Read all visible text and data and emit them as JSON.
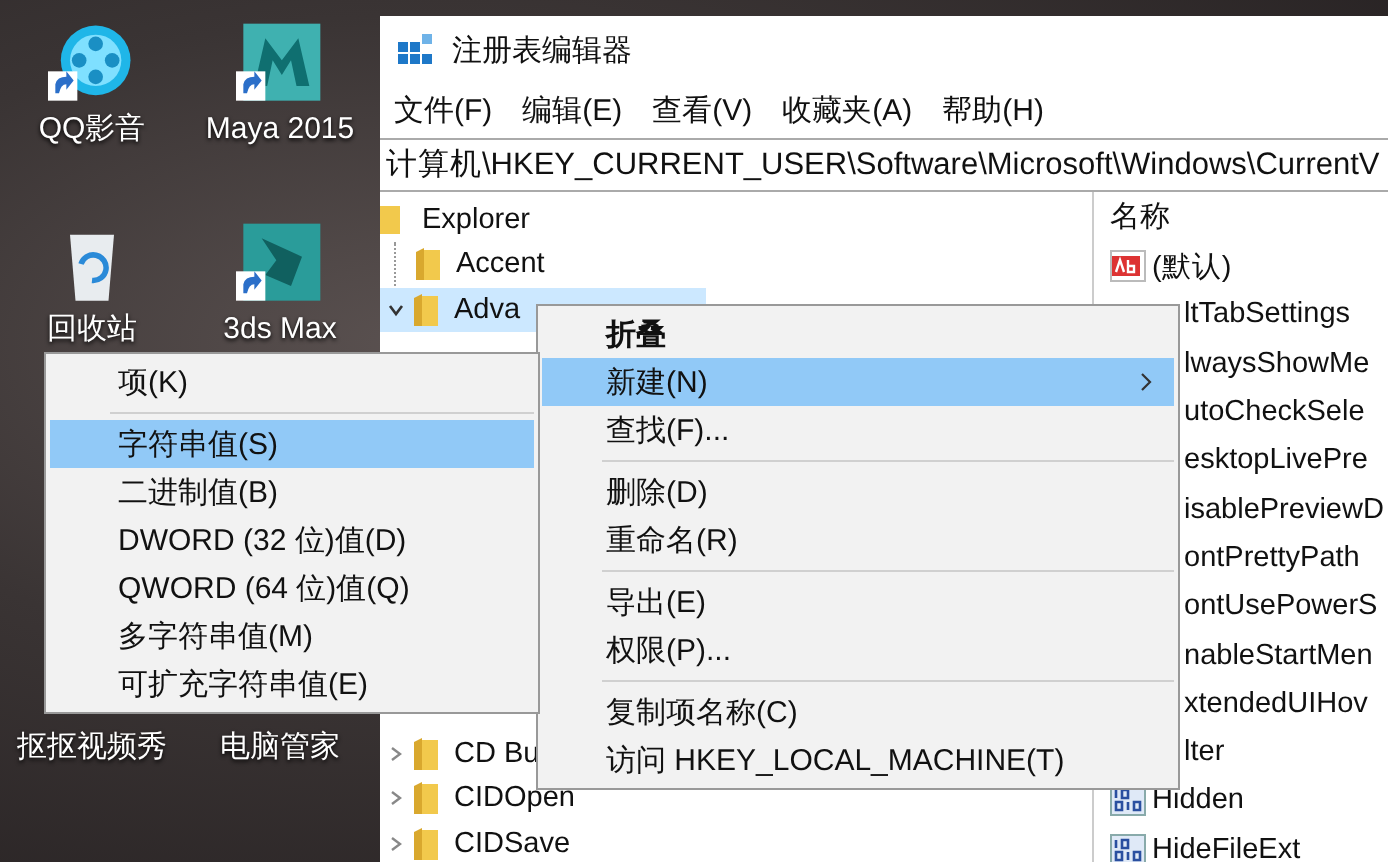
{
  "desktop": {
    "icons": [
      {
        "label": "QQ影音",
        "kind": "player",
        "shortcut": true
      },
      {
        "label": "Maya 2015",
        "kind": "maya",
        "shortcut": true
      },
      {
        "label": "回收站",
        "kind": "recycle",
        "shortcut": false
      },
      {
        "label": "3ds Max",
        "kind": "max",
        "shortcut": true
      },
      {
        "label": "抠抠视频秀",
        "kind": "covered"
      },
      {
        "label": "电脑管家",
        "kind": "covered"
      }
    ]
  },
  "window": {
    "title": "注册表编辑器",
    "menu": [
      "文件(F)",
      "编辑(E)",
      "查看(V)",
      "收藏夹(A)",
      "帮助(H)"
    ],
    "address": "计算机\\HKEY_CURRENT_USER\\Software\\Microsoft\\Windows\\CurrentV",
    "tree": [
      {
        "label": "Explorer",
        "selected": false,
        "children": [
          {
            "label": "Accent",
            "has_children": false,
            "selected": false
          },
          {
            "label": "Adva",
            "has_children": true,
            "expanded": true,
            "selected": true
          },
          {
            "label": "CD Bu",
            "has_children": true,
            "expanded": false,
            "selected": false
          },
          {
            "label": "CIDOpen",
            "has_children": true,
            "expanded": false,
            "selected": false
          },
          {
            "label": "CIDSave",
            "has_children": true,
            "expanded": false,
            "selected": false
          }
        ]
      }
    ],
    "values_header": "名称",
    "values": [
      {
        "name": "(默认)",
        "kind": "string"
      },
      {
        "name": "ltTabSettings",
        "kind": "clipped"
      },
      {
        "name": "lwaysShowMe",
        "kind": "clipped"
      },
      {
        "name": "utoCheckSele",
        "kind": "clipped"
      },
      {
        "name": "esktopLivePre",
        "kind": "clipped"
      },
      {
        "name": "isablePreviewD",
        "kind": "clipped"
      },
      {
        "name": "ontPrettyPath",
        "kind": "clipped"
      },
      {
        "name": "ontUsePowerS",
        "kind": "clipped"
      },
      {
        "name": "nableStartMen",
        "kind": "clipped"
      },
      {
        "name": "xtendedUIHov",
        "kind": "clipped"
      },
      {
        "name": "lter",
        "kind": "clipped"
      },
      {
        "name": "Hidden",
        "kind": "binary"
      },
      {
        "name": "HideFileExt",
        "kind": "binary"
      }
    ]
  },
  "context_menu": {
    "items": [
      {
        "kind": "item",
        "label": "折叠",
        "default": true,
        "selected": false,
        "submenu": false
      },
      {
        "kind": "item",
        "label": "新建(N)",
        "default": false,
        "selected": true,
        "submenu": true
      },
      {
        "kind": "item",
        "label": "查找(F)...",
        "default": false,
        "selected": false,
        "submenu": false
      },
      {
        "kind": "separator"
      },
      {
        "kind": "item",
        "label": "删除(D)",
        "default": false,
        "selected": false,
        "submenu": false
      },
      {
        "kind": "item",
        "label": "重命名(R)",
        "default": false,
        "selected": false,
        "submenu": false
      },
      {
        "kind": "separator"
      },
      {
        "kind": "item",
        "label": "导出(E)",
        "default": false,
        "selected": false,
        "submenu": false
      },
      {
        "kind": "item",
        "label": "权限(P)...",
        "default": false,
        "selected": false,
        "submenu": false
      },
      {
        "kind": "separator"
      },
      {
        "kind": "item",
        "label": "复制项名称(C)",
        "default": false,
        "selected": false,
        "submenu": false
      },
      {
        "kind": "item",
        "label": "访问 HKEY_LOCAL_MACHINE(T)",
        "default": false,
        "selected": false,
        "submenu": false
      }
    ]
  },
  "submenu": {
    "items": [
      {
        "kind": "item",
        "label": "项(K)",
        "selected": false
      },
      {
        "kind": "separator"
      },
      {
        "kind": "item",
        "label": "字符串值(S)",
        "selected": true
      },
      {
        "kind": "item",
        "label": "二进制值(B)",
        "selected": false
      },
      {
        "kind": "item",
        "label": "DWORD (32 位)值(D)",
        "selected": false
      },
      {
        "kind": "item",
        "label": "QWORD (64 位)值(Q)",
        "selected": false
      },
      {
        "kind": "item",
        "label": "多字符串值(M)",
        "selected": false
      },
      {
        "kind": "item",
        "label": "可扩充字符串值(E)",
        "selected": false
      }
    ]
  }
}
